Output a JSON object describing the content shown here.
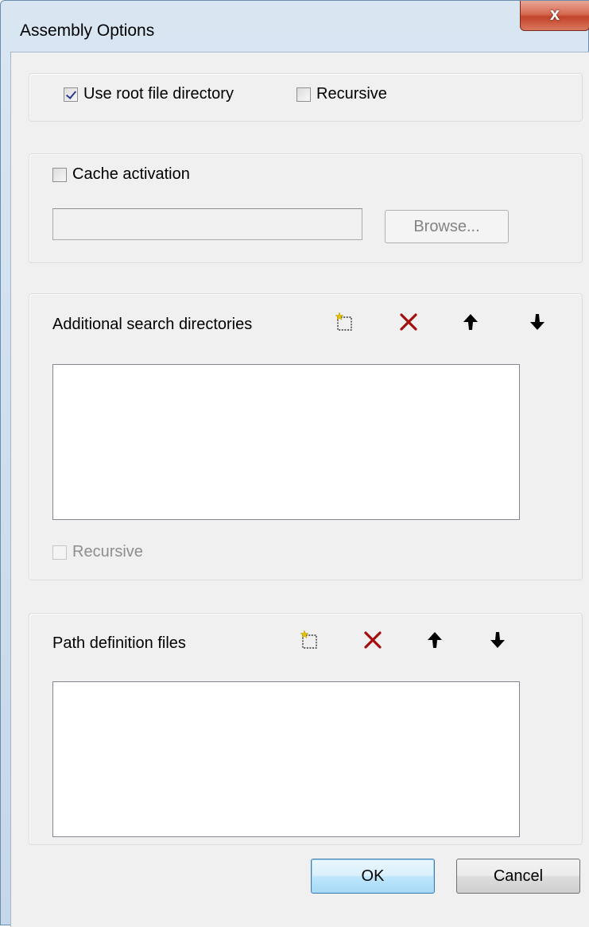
{
  "window": {
    "title": "Assembly Options",
    "close_label": "x"
  },
  "root_group": {
    "use_root_label": "Use root file directory",
    "use_root_checked": true,
    "recursive_label": "Recursive",
    "recursive_checked": false
  },
  "cache_group": {
    "cache_label": "Cache activation",
    "cache_checked": false,
    "path_value": "",
    "browse_label": "Browse..."
  },
  "search_group": {
    "title": "Additional search directories",
    "items": [],
    "recursive_label": "Recursive",
    "recursive_checked": false
  },
  "path_group": {
    "title": "Path definition files",
    "items": []
  },
  "footer": {
    "ok_label": "OK",
    "cancel_label": "Cancel"
  },
  "icons": {
    "new": "new-item-icon",
    "delete": "delete-icon",
    "up": "arrow-up-icon",
    "down": "arrow-down-icon"
  },
  "colors": {
    "delete_red": "#a30f0f",
    "new_star": "#e6c200",
    "arrow": "#000000"
  }
}
